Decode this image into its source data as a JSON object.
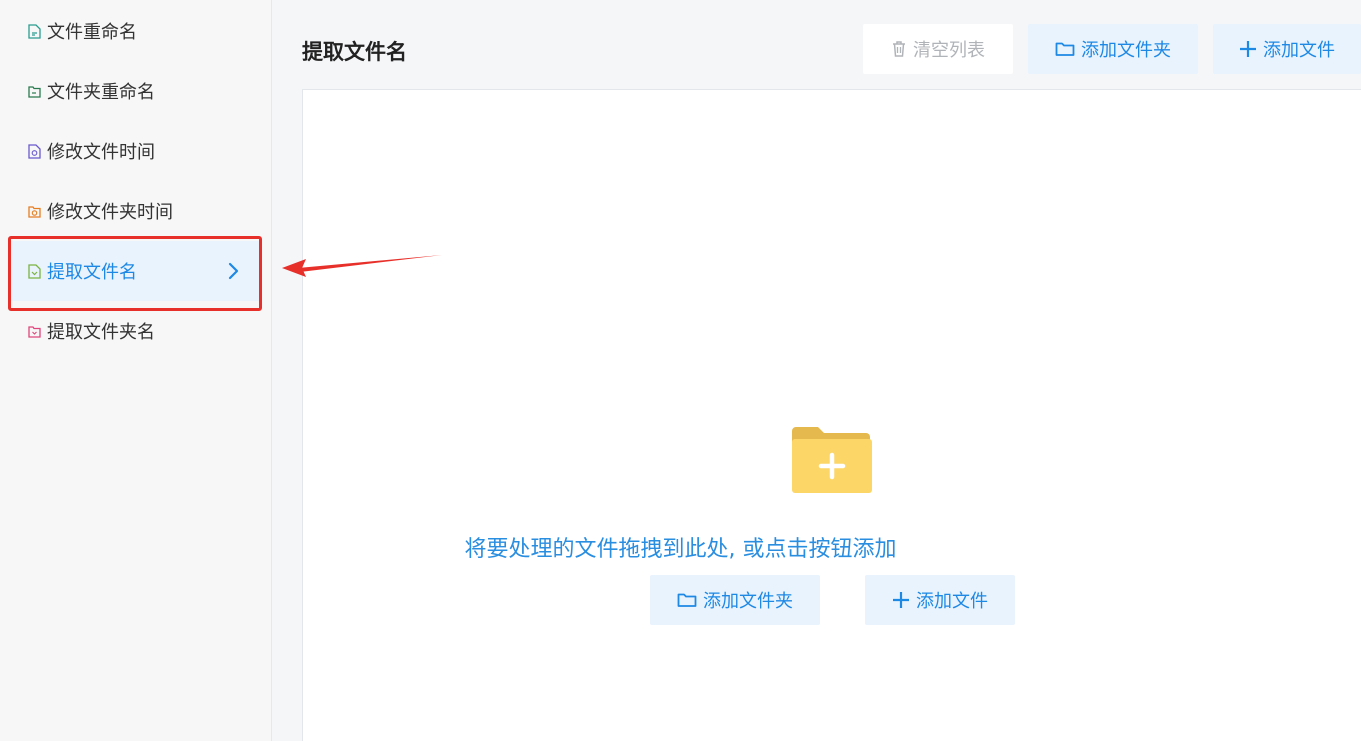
{
  "sidebar": {
    "items": [
      {
        "label": "文件重命名",
        "icon": "file-rename-icon",
        "color": "#2a9d8f"
      },
      {
        "label": "文件夹重命名",
        "icon": "folder-rename-icon",
        "color": "#2a7a4f"
      },
      {
        "label": "修改文件时间",
        "icon": "file-time-icon",
        "color": "#6a5acd"
      },
      {
        "label": "修改文件夹时间",
        "icon": "folder-time-icon",
        "color": "#e67e22"
      },
      {
        "label": "提取文件名",
        "icon": "extract-filename-icon",
        "color": "#7cb342",
        "active": true
      },
      {
        "label": "提取文件夹名",
        "icon": "extract-foldername-icon",
        "color": "#e0457b"
      }
    ]
  },
  "header": {
    "title": "提取文件名",
    "clear_label": "清空列表",
    "add_folder_label": "添加文件夹",
    "add_file_label": "添加文件"
  },
  "dropzone": {
    "hint": "将要处理的文件拖拽到此处, 或点击按钮添加",
    "add_folder_label": "添加文件夹",
    "add_file_label": "添加文件"
  },
  "colors": {
    "accent": "#1e88e5",
    "accent_bg": "#e8f3fd",
    "highlight": "#e8302a",
    "folder": "#fcd667"
  }
}
